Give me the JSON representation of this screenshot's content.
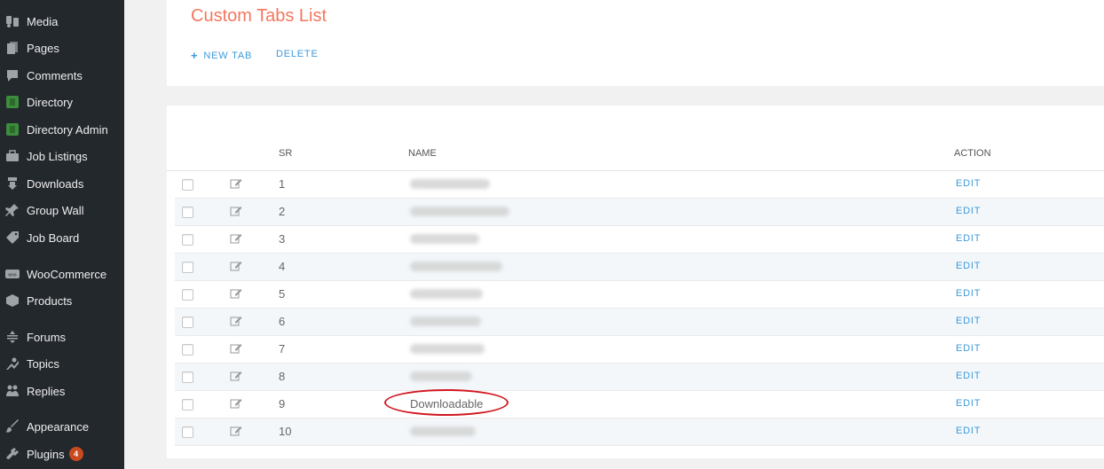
{
  "sidebar": {
    "items": [
      {
        "label": "Media",
        "icon": "media-icon"
      },
      {
        "label": "Pages",
        "icon": "pages-icon"
      },
      {
        "label": "Comments",
        "icon": "comments-icon"
      },
      {
        "label": "Directory",
        "icon": "directory-icon"
      },
      {
        "label": "Directory Admin",
        "icon": "directory-admin-icon"
      },
      {
        "label": "Job Listings",
        "icon": "briefcase-icon"
      },
      {
        "label": "Downloads",
        "icon": "download-icon"
      },
      {
        "label": "Group Wall",
        "icon": "pin-icon"
      },
      {
        "label": "Job Board",
        "icon": "tag-icon"
      },
      {
        "label": "WooCommerce",
        "icon": "woocommerce-icon"
      },
      {
        "label": "Products",
        "icon": "cube-icon"
      },
      {
        "label": "Forums",
        "icon": "forums-icon"
      },
      {
        "label": "Topics",
        "icon": "topics-icon"
      },
      {
        "label": "Replies",
        "icon": "replies-icon"
      },
      {
        "label": "Appearance",
        "icon": "brush-icon"
      },
      {
        "label": "Plugins",
        "icon": "plugin-icon",
        "badge": "4"
      }
    ]
  },
  "page": {
    "title": "Custom Tabs List",
    "new_tab_label": "NEW TAB",
    "delete_label": "DELETE"
  },
  "table": {
    "headers": {
      "sr": "SR",
      "name": "NAME",
      "action": "ACTION"
    },
    "rows": [
      {
        "sr": "1",
        "name": "",
        "action": "EDIT"
      },
      {
        "sr": "2",
        "name": "",
        "action": "EDIT"
      },
      {
        "sr": "3",
        "name": "",
        "action": "EDIT"
      },
      {
        "sr": "4",
        "name": "",
        "action": "EDIT"
      },
      {
        "sr": "5",
        "name": "",
        "action": "EDIT"
      },
      {
        "sr": "6",
        "name": "",
        "action": "EDIT"
      },
      {
        "sr": "7",
        "name": "",
        "action": "EDIT"
      },
      {
        "sr": "8",
        "name": "",
        "action": "EDIT"
      },
      {
        "sr": "9",
        "name": "Downloadable",
        "action": "EDIT",
        "highlighted": true
      },
      {
        "sr": "10",
        "name": "",
        "action": "EDIT"
      }
    ]
  },
  "colors": {
    "sidebar_bg": "#23282d",
    "title": "#f4775f",
    "link": "#3d9ad9",
    "highlight_circle": "#d2161f",
    "badge": "#ca4a1f"
  }
}
